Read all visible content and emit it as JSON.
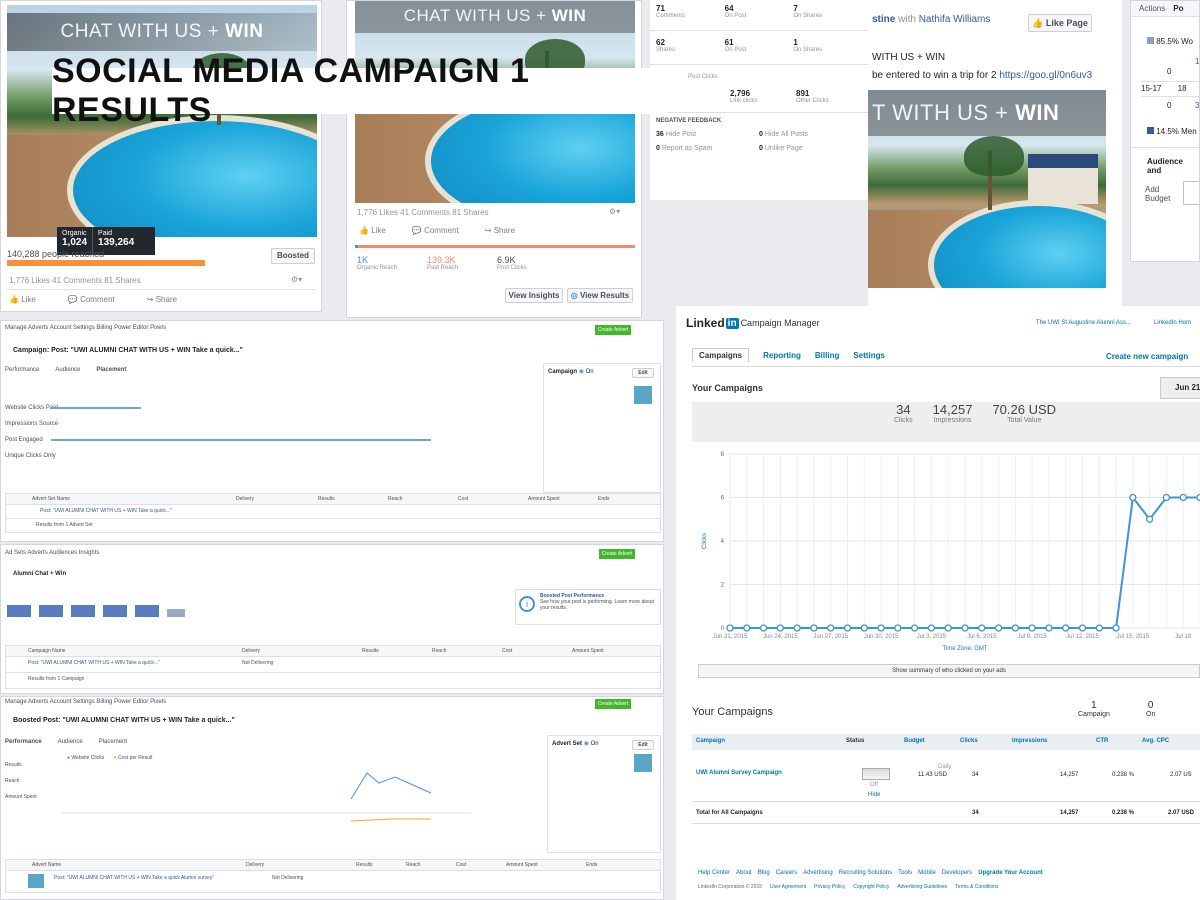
{
  "banner": {
    "title": "SOCIAL MEDIA CAMPAIGN 1 RESULTS"
  },
  "post1": {
    "image_caption_light": "CHAT WITH US + ",
    "image_caption_bold": "WIN",
    "organic_label": "Organic",
    "organic_value": "1,024",
    "paid_label": "Paid",
    "paid_value": "139,264",
    "people_reached": "140,288 people reached",
    "boosted_label": "Boosted",
    "stats": "1,776 Likes   41 Comments   81 Shares",
    "like": "Like",
    "comment": "Comment",
    "share": "Share"
  },
  "post2": {
    "image_caption_light": "CHAT WITH US + ",
    "image_caption_bold": "WIN",
    "stats": "1,776 Likes  41 Comments  81 Shares",
    "like": "Like",
    "comment": "Comment",
    "share": "Share",
    "organic_reach": "1K",
    "organic_reach_label": "Organic Reach",
    "paid_reach": "139.3K",
    "paid_reach_label": "Paid Reach",
    "post_clicks": "6.9K",
    "post_clicks_label": "Post Clicks",
    "view_insights": "View Insights",
    "view_results": "View Results"
  },
  "insights": {
    "r1": [
      {
        "v": "71",
        "l": "Comments"
      },
      {
        "v": "64",
        "l": "On Post"
      },
      {
        "v": "7",
        "l": "On Shares"
      }
    ],
    "r2": [
      {
        "v": "62",
        "l": "Shares"
      },
      {
        "v": "61",
        "l": "On Post"
      },
      {
        "v": "1",
        "l": "On Shares"
      }
    ],
    "post_clicks_title": "Post Clicks",
    "r3": [
      {
        "v": "2,796",
        "l": "Link clicks"
      },
      {
        "v": "891",
        "l": "Other Clicks"
      }
    ],
    "negative_title": "NEGATIVE FEEDBACK",
    "neg": [
      {
        "v": "36",
        "l": "Hide Post"
      },
      {
        "v": "0",
        "l": "Hide All Posts"
      },
      {
        "v": "0",
        "l": "Report as Spam"
      },
      {
        "v": "0",
        "l": "Unlike Page"
      }
    ]
  },
  "post3": {
    "author": "stine",
    "with": "with",
    "tagged": "Nathifa Williams",
    "like_page": "Like Page",
    "text1": "WITH US + WIN",
    "text2": "be entered to win a trip for 2",
    "link": "https://goo.gl/0n6uv3",
    "image_caption_light": "T WITH US + ",
    "image_caption_bold": "WIN"
  },
  "right_strip": {
    "tab1": "Actions",
    "tab2": "Po",
    "pct_women": "85.5% Wo",
    "v0a": "0",
    "v1": "1.",
    "age": "15-17",
    "age2": "18",
    "v0b": "0",
    "v3": "3",
    "pct_men": "14.5% Men",
    "audience": "Audience and",
    "add_budget": "Add Budget"
  },
  "linkedin": {
    "logo_text": "Linked",
    "logo_in": "in",
    "product": "Campaign Manager",
    "account": "The UWI St Augustine Alumni Ass...",
    "home_link": "LinkedIn Hom",
    "tabs": [
      "Campaigns",
      "Reporting",
      "Billing",
      "Settings"
    ],
    "create": "Create new campaign",
    "your_campaigns": "Your Campaigns",
    "date": "Jun 21,",
    "clicks": "34",
    "clicks_label": "Clicks",
    "impressions": "14,257",
    "impressions_label": "Impressions",
    "total_value": "70.26 USD",
    "total_value_label": "Total Value",
    "summary": "Show summary of who clicked on your ads",
    "your_campaigns2": "Your Campaigns",
    "campaign_count": "1",
    "campaign_count_label": "Campaign",
    "on_count": "0",
    "on_label": "On",
    "cols": [
      "Campaign",
      "Status",
      "Budget",
      "Clicks",
      "Impressions",
      "CTR",
      "Avg. CPC"
    ],
    "row": {
      "name": "UWI Alumni Survey Campaign",
      "status": "Off",
      "status_link": "Hide",
      "budget_label": "Daily",
      "budget": "11.43 USD",
      "clicks": "34",
      "impressions": "14,257",
      "ctr": "0.238 %",
      "cpc": "2.07 US"
    },
    "total": {
      "name": "Total for All Campaigns",
      "clicks": "34",
      "impressions": "14,257",
      "ctr": "0.238 %",
      "cpc": "2.07 USD"
    },
    "footer_links": [
      "Help Center",
      "About",
      "Blog",
      "Careers",
      "Advertising",
      "Recruiting Solutions",
      "Tools",
      "Mobile",
      "Developers",
      "Upgrade Your Account"
    ],
    "footer2": [
      "LinkedIn Corporation © 2015",
      "User Agreement",
      "Privacy Policy",
      "Copyright Policy",
      "Advertising Guidelines",
      "Terms & Conditions"
    ]
  },
  "li_chart": {
    "ylabel": "Clicks",
    "xlabel": "Time Zone: GMT",
    "ticks_y": [
      "0",
      "2",
      "4",
      "6",
      "8"
    ],
    "ticks_x": [
      "Jun 21, 2015",
      "Jun 24, 2015",
      "Jun 27, 2015",
      "Jun 30, 2015",
      "Jul 3, 2015",
      "Jul 6, 2015",
      "Jul 9, 2015",
      "Jul 12, 2015",
      "Jul 15, 2015",
      "Jul 18"
    ]
  },
  "chart_data": {
    "type": "line",
    "x": [
      "Jun 21",
      "Jun 22",
      "Jun 23",
      "Jun 24",
      "Jun 25",
      "Jun 26",
      "Jun 27",
      "Jun 28",
      "Jun 29",
      "Jun 30",
      "Jul 1",
      "Jul 2",
      "Jul 3",
      "Jul 4",
      "Jul 5",
      "Jul 6",
      "Jul 7",
      "Jul 8",
      "Jul 9",
      "Jul 10",
      "Jul 11",
      "Jul 12",
      "Jul 13",
      "Jul 14",
      "Jul 15",
      "Jul 16",
      "Jul 17",
      "Jul 18",
      "Jul 19"
    ],
    "series": [
      {
        "values": [
          0,
          0,
          0,
          0,
          0,
          0,
          0,
          0,
          0,
          0,
          0,
          0,
          0,
          0,
          0,
          0,
          0,
          0,
          0,
          0,
          0,
          0,
          0,
          0,
          6,
          5,
          6,
          6,
          6
        ]
      }
    ],
    "xlabel": "Time Zone: GMT",
    "ylabel": "Clicks",
    "ylim": [
      0,
      8
    ]
  },
  "ads1": {
    "nav": "Manage Adverts   Account Settings   Billing   Power Editor   Pixels",
    "title": "Campaign: Post: \"UWI ALUMNI CHAT WITH US + WIN Take a quick...\"",
    "create_btn": "Create Advert",
    "tabs": [
      "Performance",
      "Audience",
      "Placement"
    ],
    "rows": [
      "Website Clicks Paid",
      "Impressions Source",
      "Post Engaged",
      "Unique Clicks Only"
    ],
    "side_title": "Campaign",
    "side_status": "On",
    "edit": "Edit",
    "table_cols": [
      "Advert Set Name",
      "Delivery",
      "Results",
      "Reach",
      "Cost",
      "Amount Spent",
      "Ends"
    ],
    "row1": "Post: \"UWI ALUMNI CHAT WITH US + WIN Take a quick...\"",
    "row2": "Results from 1 Advert Set"
  },
  "ads2": {
    "nav": "Ad Sets   Adverts   Audiences   Insights",
    "title": "Alumni Chat + Win",
    "create_btn": "Create Advert",
    "notice_title": "Boosted Post Performance",
    "notice_text": "See how your post is performing. Learn more about your results.",
    "table_cols": [
      "Campaign Name",
      "Delivery",
      "Results",
      "Reach",
      "Cost",
      "Amount Spent"
    ],
    "row1": "Post: \"UWI ALUMNI CHAT WITH US + WIN Take a quick...\"",
    "row1_status": "Not Delivering",
    "row2": "Results from 1 Campaign"
  },
  "ads3": {
    "nav": "Manage Adverts   Account Settings   Billing   Power Editor   Pixels",
    "title": "Boosted Post: \"UWI ALUMNI CHAT WITH US + WIN Take a quick...\"",
    "create_btn": "Create Advert",
    "tabs": [
      "Performance",
      "Audience",
      "Placement"
    ],
    "legend1": "Website Clicks",
    "legend2": "Cost per Result",
    "side_title": "Advert Set",
    "side_status": "On",
    "edit": "Edit",
    "left_metrics": [
      "Results",
      "Reach",
      "Amount Spent"
    ],
    "table_cols": [
      "Advert Name",
      "Delivery",
      "Results",
      "Reach",
      "Cost",
      "Amount Spent",
      "Ends"
    ],
    "row1": "Post: \"UWI ALUMNI CHAT WITH US + WIN Take a quick Alumni survey\"",
    "row1_status": "Not Delivering"
  }
}
